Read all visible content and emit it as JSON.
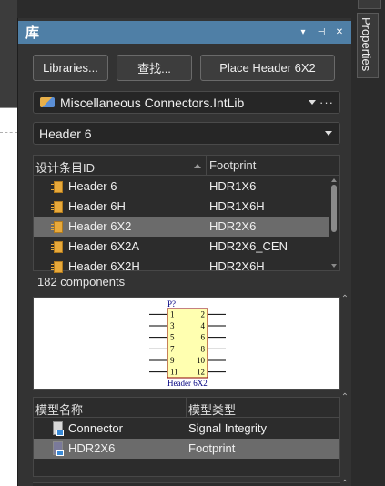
{
  "panel": {
    "title": "库",
    "title_buttons": [
      "▾",
      "⊣",
      "✕"
    ]
  },
  "toolbar": {
    "libraries_label": "Libraries...",
    "search_label": "查找...",
    "place_label": "Place Header 6X2"
  },
  "library_select": {
    "value": "Miscellaneous Connectors.IntLib",
    "more": "···"
  },
  "filter_select": {
    "value": "Header 6"
  },
  "components": {
    "col_id": "设计条目ID",
    "col_footprint": "Footprint",
    "rows": [
      {
        "name": "Header 6",
        "footprint": "HDR1X6",
        "selected": false
      },
      {
        "name": "Header 6H",
        "footprint": "HDR1X6H",
        "selected": false
      },
      {
        "name": "Header 6X2",
        "footprint": "HDR2X6",
        "selected": true
      },
      {
        "name": "Header 6X2A",
        "footprint": "HDR2X6_CEN",
        "selected": false
      },
      {
        "name": "Header 6X2H",
        "footprint": "HDR2X6H",
        "selected": false
      }
    ],
    "count": "182 components",
    "scroll_fraction": 0.0
  },
  "preview": {
    "designator": "P?",
    "comment": "Header 6X2",
    "left_pins": [
      "1",
      "3",
      "5",
      "7",
      "9",
      "11"
    ],
    "right_pins": [
      "2",
      "4",
      "6",
      "8",
      "10",
      "12"
    ]
  },
  "models": {
    "col_name": "模型名称",
    "col_type": "模型类型",
    "rows": [
      {
        "name": "Connector",
        "type": "Signal Integrity",
        "selected": false
      },
      {
        "name": "HDR2X6",
        "type": "Footprint",
        "selected": true
      }
    ]
  },
  "sidebar": {
    "properties_label": "Properties"
  },
  "colors": {
    "title_bar": "#4f7fa6",
    "selected_row": "#6b6b6b",
    "symbol_fill": "#ffffb0",
    "symbol_border": "#8b0000",
    "symbol_text": "#000080"
  }
}
